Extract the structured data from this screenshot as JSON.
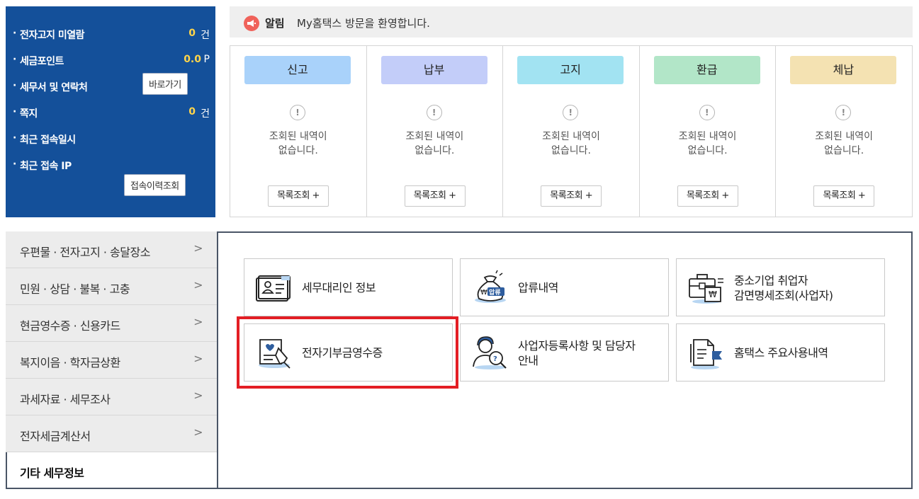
{
  "info_panel": {
    "unread_notice_label": "전자고지 미열람",
    "unread_notice_value": "0",
    "unread_notice_unit": "건",
    "tax_point_label": "세금포인트",
    "tax_point_value": "0.0",
    "tax_point_unit": "P",
    "tax_office_label": "세무서 및 연락처",
    "tax_office_button": "바로가기",
    "message_label": "쪽지",
    "message_value": "0",
    "message_unit": "건",
    "last_login_label": "최근 접속일시",
    "last_ip_label": "최근 접속 IP",
    "login_history_button": "접속이력조회"
  },
  "notice": {
    "title": "알림",
    "message": "My홈택스 방문을 환영합니다."
  },
  "status_columns": [
    {
      "title": "신고",
      "empty_line1": "조회된 내역이",
      "empty_line2": "없습니다.",
      "more": "목록조회 +",
      "color": "#a9d2fa"
    },
    {
      "title": "납부",
      "empty_line1": "조회된 내역이",
      "empty_line2": "없습니다.",
      "more": "목록조회 +",
      "color": "#c3cdf9"
    },
    {
      "title": "고지",
      "empty_line1": "조회된 내역이",
      "empty_line2": "없습니다.",
      "more": "목록조회 +",
      "color": "#a2e3f2"
    },
    {
      "title": "환급",
      "empty_line1": "조회된 내역이",
      "empty_line2": "없습니다.",
      "more": "목록조회 +",
      "color": "#b2e6c8"
    },
    {
      "title": "체납",
      "empty_line1": "조회된 내역이",
      "empty_line2": "없습니다.",
      "more": "목록조회 +",
      "color": "#f4e2b2"
    }
  ],
  "side_menu": [
    {
      "label": "우편물 · 전자고지 · 송달장소"
    },
    {
      "label": "민원 · 상담 · 불복 · 고충"
    },
    {
      "label": "현금영수증 · 신용카드"
    },
    {
      "label": "복지이음 · 학자금상환"
    },
    {
      "label": "과세자료 · 세무조사"
    },
    {
      "label": "전자세금계산서"
    },
    {
      "label": "기타 세무정보"
    }
  ],
  "cards": {
    "tax_agent": {
      "label": "세무대리인 정보",
      "icon": "id-card-icon"
    },
    "seizure": {
      "label": "압류내역",
      "icon": "money-bag-icon",
      "icon_text": "압류"
    },
    "sme_line1": {
      "label": "중소기업 취업자"
    },
    "sme_line2": {
      "label": "감면명세조회(사업자)"
    },
    "sme_icon": {
      "icon": "briefcase-won-icon",
      "icon_text": "₩"
    },
    "donation": {
      "label": "전자기부금영수증",
      "icon": "donation-receipt-icon"
    },
    "business_line1": {
      "label": "사업자등록사항 및 담당자"
    },
    "business_line2": {
      "label": "안내"
    },
    "business_icon": {
      "icon": "person-search-icon"
    },
    "usage": {
      "label": "홈택스 주요사용내역",
      "icon": "document-flag-icon"
    }
  },
  "colors": {
    "panel_blue": "#14509a",
    "highlight_red": "#e31e24",
    "value_yellow": "#ffd54a"
  }
}
